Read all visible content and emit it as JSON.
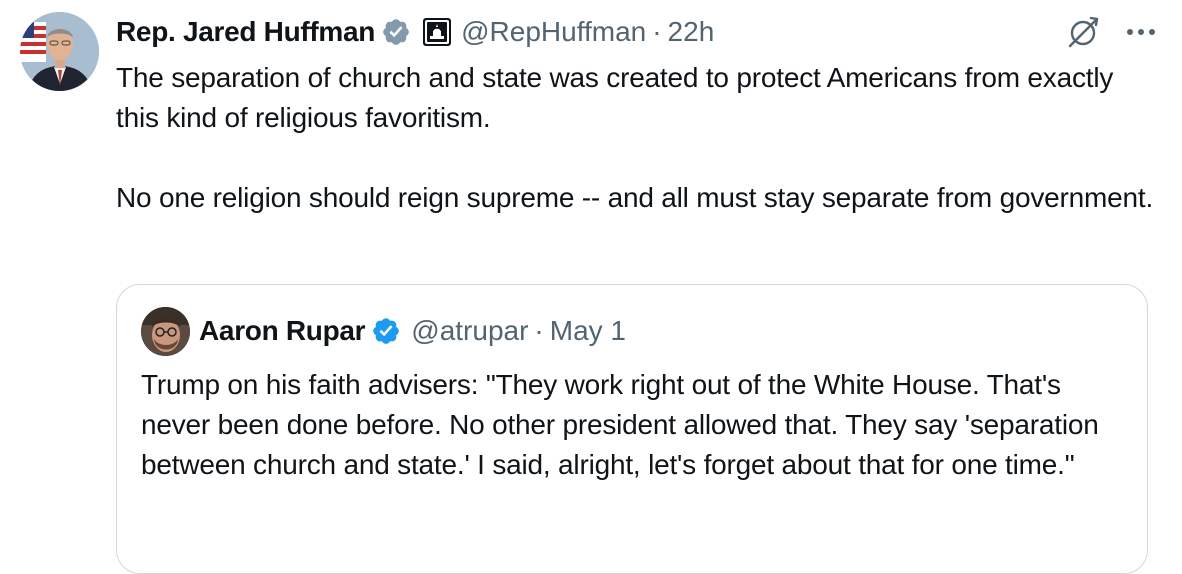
{
  "tweet": {
    "author": {
      "display_name": "Rep. Jared Huffman",
      "handle": "@RepHuffman",
      "verified": "gray-verified-badge",
      "affiliation": "us-capitol-icon",
      "avatar": "avatar-rep-huffman"
    },
    "separator": "·",
    "time": "22h",
    "actions": {
      "grok": "grok-icon",
      "more": "more-icon"
    },
    "text": {
      "paragraph_1": "The separation of church and state was created to protect Americans from exactly this kind of religious favoritism.",
      "paragraph_2": "No one religion should reign supreme -- and all must stay separate from government."
    }
  },
  "quoted_tweet": {
    "author": {
      "display_name": "Aaron Rupar",
      "handle": "@atrupar",
      "verified": "blue-verified-badge",
      "avatar": "avatar-aaron-rupar"
    },
    "separator": "·",
    "time": "May 1",
    "text": "Trump on his faith advisers: \"They work right out of the White House. That's never been done before. No other president allowed that. They say 'separation between church and state.' I said, alright, let's forget about that for one time.\""
  },
  "colors": {
    "text_primary": "#0f1419",
    "text_secondary": "#536471",
    "verified_blue": "#1d9bf0",
    "verified_gray": "#829aab",
    "border": "#cfd9de"
  }
}
